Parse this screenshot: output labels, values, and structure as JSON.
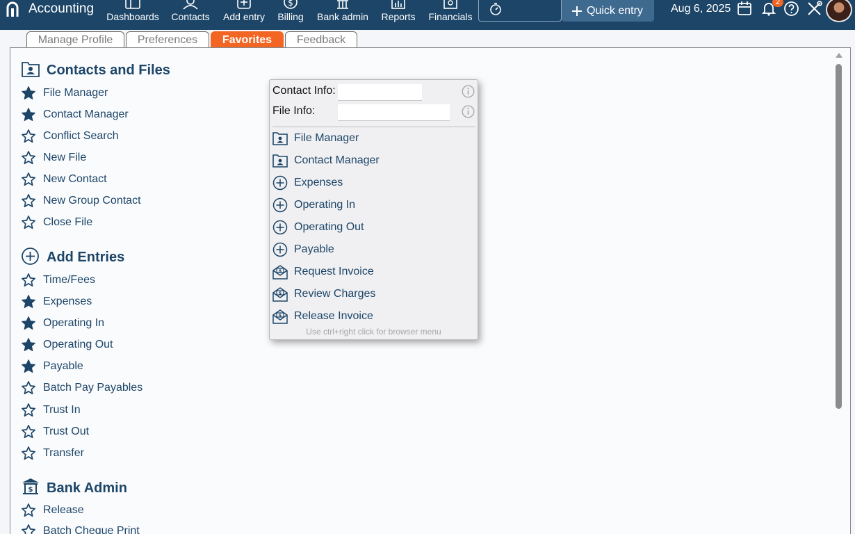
{
  "app": {
    "title": "Accounting"
  },
  "nav": [
    {
      "label": "Dashboards",
      "icon": "dashboard-icon"
    },
    {
      "label": "Contacts",
      "icon": "contacts-icon"
    },
    {
      "label": "Add entry",
      "icon": "add-entry-icon"
    },
    {
      "label": "Billing",
      "icon": "billing-icon"
    },
    {
      "label": "Bank admin",
      "icon": "bank-icon"
    },
    {
      "label": "Reports",
      "icon": "reports-icon"
    },
    {
      "label": "Financials",
      "icon": "financials-icon"
    }
  ],
  "header": {
    "quick_entry_label": "Quick entry",
    "date": "Aug 6, 2025",
    "notification_count": "2"
  },
  "tabs": [
    {
      "label": "Manage Profile",
      "active": false
    },
    {
      "label": "Preferences",
      "active": false
    },
    {
      "label": "Favorites",
      "active": true
    },
    {
      "label": "Feedback",
      "active": false
    }
  ],
  "sections": [
    {
      "title": "Contacts and Files",
      "icon": "contact-folder-icon",
      "items": [
        {
          "label": "File Manager",
          "favorite": true
        },
        {
          "label": "Contact Manager",
          "favorite": true
        },
        {
          "label": "Conflict Search",
          "favorite": false
        },
        {
          "label": "New File",
          "favorite": false
        },
        {
          "label": "New Contact",
          "favorite": false
        },
        {
          "label": "New Group Contact",
          "favorite": false
        },
        {
          "label": "Close File",
          "favorite": false
        }
      ]
    },
    {
      "title": "Add Entries",
      "icon": "plus-circle-icon",
      "items": [
        {
          "label": "Time/Fees",
          "favorite": false
        },
        {
          "label": "Expenses",
          "favorite": true
        },
        {
          "label": "Operating In",
          "favorite": true
        },
        {
          "label": "Operating Out",
          "favorite": true
        },
        {
          "label": "Payable",
          "favorite": true
        },
        {
          "label": "Batch Pay Payables",
          "favorite": false
        },
        {
          "label": "Trust In",
          "favorite": false
        },
        {
          "label": "Trust Out",
          "favorite": false
        },
        {
          "label": "Transfer",
          "favorite": false
        }
      ]
    },
    {
      "title": "Bank Admin",
      "icon": "bank-icon",
      "items": [
        {
          "label": "Release",
          "favorite": false
        },
        {
          "label": "Batch Cheque Print",
          "favorite": false
        }
      ]
    }
  ],
  "context_menu": {
    "contact_info_label": "Contact Info:",
    "contact_info_value": "",
    "file_info_label": "File Info:",
    "file_info_value": "",
    "items": [
      {
        "label": "File Manager",
        "icon": "contact-folder-icon"
      },
      {
        "label": "Contact Manager",
        "icon": "contact-folder-icon"
      },
      {
        "label": "Expenses",
        "icon": "plus-circle-icon"
      },
      {
        "label": "Operating In",
        "icon": "plus-circle-icon"
      },
      {
        "label": "Operating Out",
        "icon": "plus-circle-icon"
      },
      {
        "label": "Payable",
        "icon": "plus-circle-icon"
      },
      {
        "label": "Request Invoice",
        "icon": "invoice-envelope-icon"
      },
      {
        "label": "Review Charges",
        "icon": "invoice-envelope-icon"
      },
      {
        "label": "Release Invoice",
        "icon": "invoice-envelope-icon"
      }
    ],
    "hint": "Use ctrl+right click for browser menu"
  },
  "colors": {
    "topbar": "#1c4568",
    "accent": "#f26522",
    "text_primary": "#1c4568"
  }
}
